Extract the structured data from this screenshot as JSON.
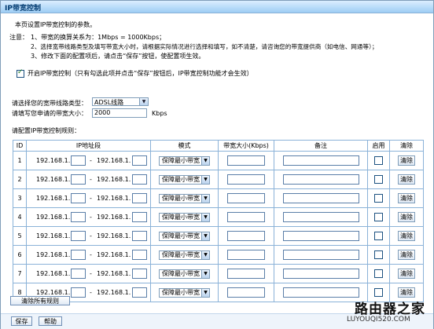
{
  "window": {
    "title": "IP带宽控制"
  },
  "intro": {
    "line1": "本页设置IP带宽控制的参数。",
    "note_label": "注意：",
    "note1": "1、带宽的换算关系为：1Mbps = 1000Kbps；",
    "note2": "2、选择宽带线路类型及填写带宽大小时，请根据实际情况进行选择和填写，如不清楚，请咨询您的带宽提供商（如电信、网通等）；",
    "note3": "3、修改下面的配置项后，请点击“保存”按钮，使配置项生效。"
  },
  "enable": {
    "checked": true,
    "label": "开启IP带宽控制（只有勾选此项并点击“保存”按钮后，IP带宽控制功能才会生效）"
  },
  "line_type": {
    "label": "请选择您的宽带线路类型：",
    "value": "ADSL线路"
  },
  "bandwidth": {
    "label": "请填写您申请的带宽大小：",
    "value": "2000",
    "unit": "Kbps"
  },
  "rules_label": "请配置IP带宽控制规则：",
  "table": {
    "headers": [
      "ID",
      "IP地址段",
      "模式",
      "带宽大小(Kbps)",
      "备注",
      "启用",
      "清除"
    ],
    "ip_prefix": "192.168.1.",
    "dash": "-",
    "rows": [
      {
        "id": "1",
        "mode": "保障最小带宽",
        "clear": "清除"
      },
      {
        "id": "2",
        "mode": "保障最小带宽",
        "clear": "清除"
      },
      {
        "id": "3",
        "mode": "保障最小带宽",
        "clear": "清除"
      },
      {
        "id": "4",
        "mode": "保障最小带宽",
        "clear": "清除"
      },
      {
        "id": "5",
        "mode": "保障最小带宽",
        "clear": "清除"
      },
      {
        "id": "6",
        "mode": "保障最小带宽",
        "clear": "清除"
      },
      {
        "id": "7",
        "mode": "保障最小带宽",
        "clear": "清除"
      },
      {
        "id": "8",
        "mode": "保障最小带宽",
        "clear": "清除"
      }
    ]
  },
  "buttons": {
    "clear_all": "清除所有规则",
    "save": "保存",
    "help": "帮助"
  },
  "watermark": {
    "brand": "路由器之家",
    "url": "LUYOUQI520.COM"
  }
}
